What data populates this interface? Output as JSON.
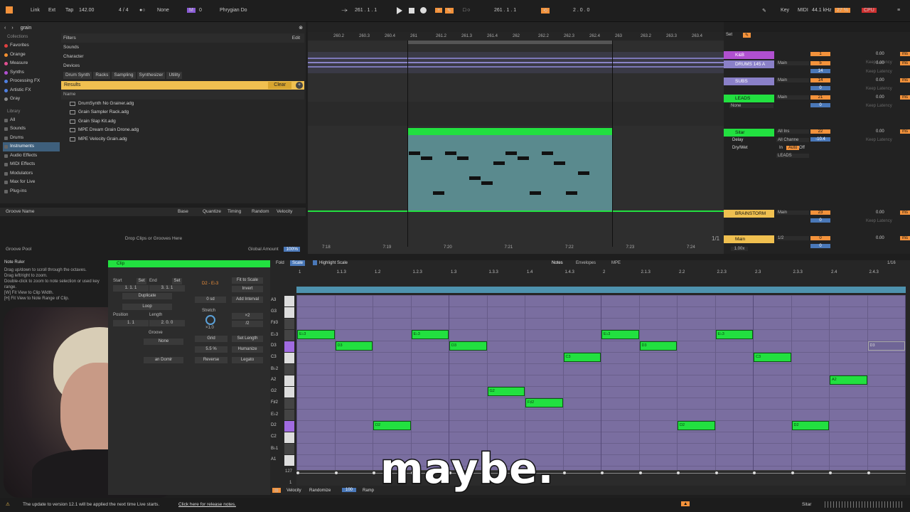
{
  "topbar": {
    "link": "Link",
    "ext": "Ext",
    "tap": "Tap",
    "tempo": "142.00",
    "sig": "4 / 4",
    "none1": "None",
    "key_num": "0",
    "scale": "Phrygian Do",
    "pos1": "261 .  1 .  1",
    "pos2": "261 .  1 .  1",
    "loop": "2 .  0 .  0",
    "key": "Key",
    "midi": "MIDI",
    "rate": "44.1 kHz",
    "cpu_pct": "27 %",
    "cpu": "CPU"
  },
  "browser": {
    "search": "grain",
    "filters": "Filters",
    "edit": "Edit",
    "sounds": "Sounds",
    "character": "Character",
    "devices": "Devices",
    "chips": [
      "Drum Synth",
      "Racks",
      "Sampling",
      "Synthesizer",
      "Utility"
    ],
    "collections_label": "Collections",
    "collections": [
      {
        "label": "Favorites",
        "color": "#e04040"
      },
      {
        "label": "Orange",
        "color": "#f39030"
      },
      {
        "label": "Measure",
        "color": "#e05090"
      },
      {
        "label": "Synths",
        "color": "#b050d0"
      },
      {
        "label": "Processing FX",
        "color": "#5080e0"
      },
      {
        "label": "Artistic FX",
        "color": "#5080e0"
      },
      {
        "label": "Gray",
        "color": "#888888"
      }
    ],
    "library_label": "Library",
    "library": [
      "All",
      "Sounds",
      "Drums",
      "Instruments",
      "Audio Effects",
      "MIDI Effects",
      "Modulators",
      "Max for Live",
      "Plug-ins"
    ],
    "results": "Results",
    "clear": "Clear",
    "name_col": "Name",
    "files": [
      "DrumSynth No Grainer.adg",
      "Grain Sampler Rack.adg",
      "Grain Slap Kit.adg",
      "MPE Dream Grain Drone.adg",
      "MPE Velocity Grain.adg"
    ]
  },
  "groove": {
    "name": "Groove Name",
    "base": "Base",
    "quantize": "Quantize",
    "timing": "Timing",
    "random": "Random",
    "velocity": "Velocity",
    "drop": "Drop Clips or Grooves Here",
    "pool": "Groove Pool",
    "global": "Global Amount",
    "global_pct": "100%"
  },
  "arrangement": {
    "bars": [
      "260.2",
      "260.3",
      "260.4",
      "261",
      "261.2",
      "261.3",
      "261.4",
      "262",
      "262.2",
      "262.3",
      "262.4",
      "263",
      "263.2",
      "263.3",
      "263.4"
    ],
    "times": [
      "7:18",
      "7:19",
      "7:20",
      "7:21",
      "7:22",
      "7:23",
      "7:24"
    ],
    "fraction": "1/1"
  },
  "mixer": {
    "set": "Set",
    "tracks": [
      {
        "name": "K&B",
        "color": "#b050d0",
        "out": "",
        "num": "1",
        "vol": "0.00"
      },
      {
        "name": "DRUMS 145 A",
        "color": "#8a80c8",
        "out": "Main",
        "num": "5",
        "vol": "0.00",
        "val2": "14"
      },
      {
        "name": "SUBS",
        "color": "#8a80c8",
        "out": "Main",
        "num": "14",
        "vol": "0.00",
        "val2": "0"
      },
      {
        "name": "LEADS",
        "color": "#22e040",
        "out": "Main",
        "num": "21",
        "vol": "0.00",
        "val2": "0"
      },
      {
        "name": "Sitar",
        "color": "#22e040",
        "out": "All Ins",
        "num": "22",
        "vol": "0.00",
        "val2": "-10.4"
      },
      {
        "name": "BRAINSTORM",
        "color": "#f0c050",
        "out": "Main",
        "num": "23",
        "vol": "0.00",
        "val2": "0"
      },
      {
        "name": "Main",
        "color": "#f0c050",
        "out": "1/2",
        "num": "0",
        "vol": "0.00",
        "val2": "0"
      }
    ],
    "none": "None",
    "delay": "Delay",
    "drywet": "Dry/Wet",
    "allchan": "All Channe",
    "leads_in": "LEADS",
    "in": "In",
    "auto": "Auto",
    "off": "Off",
    "keep": "Keep Latency",
    "zoom": "1.00x"
  },
  "noteruler": {
    "title": "Note Ruler",
    "lines": [
      "Drag up/down to scroll through the octaves.",
      "Drag left/right to zoom.",
      "Double-click to zoom to note selection or used key range.",
      "[W] Fit View to Clip Width.",
      "[H] Fit View to Note Range of Clip."
    ]
  },
  "clip": {
    "title": "Clip",
    "start": "Start",
    "end": "End",
    "set": "Set",
    "start_val": "1.  1.  1",
    "end_val": "3.  1.  1",
    "duplicate": "Duplicate",
    "loop": "Loop",
    "position": "Position",
    "length": "Length",
    "pos_val": "1.  1",
    "len_val": "2.  0.  0",
    "groove": "Groove",
    "groove_val": "None",
    "range": "D2 - E♭3",
    "fit": "Fit to Scale",
    "invert": "Invert",
    "sd": "0 sd",
    "interval": "Add Interval",
    "stretch": "Stretch",
    "x2": "×2",
    "d2": "/2",
    "stretch_val": "×1.0",
    "grid": "Grid",
    "setlen": "Set Length",
    "grid_pct": "5.5 %",
    "humanize": "Humanize",
    "reverse": "Reverse",
    "legato": "Legato",
    "scale_name": "an Domir"
  },
  "pianoroll": {
    "fold": "Fold",
    "scale": "Scale",
    "highlight": "Highlight Scale",
    "notes_tab": "Notes",
    "env_tab": "Envelopes",
    "mpe_tab": "MPE",
    "quant": "1/16",
    "ruler": [
      "1",
      "1.1.3",
      "1.2",
      "1.2.3",
      "1.3",
      "1.3.3",
      "1.4",
      "1.4.3",
      "2",
      "2.1.3",
      "2.2",
      "2.2.3",
      "2.3",
      "2.3.3",
      "2.4",
      "2.4.3"
    ],
    "keys": [
      "A3",
      "G3",
      "F♯3",
      "E♭3",
      "D3",
      "C3",
      "B♭2",
      "A2",
      "G2",
      "F♯2",
      "E♭2",
      "D2",
      "C2",
      "B♭1",
      "A1"
    ],
    "notes": [
      {
        "label": "E♭3",
        "row": 3,
        "start": 0,
        "len": 1
      },
      {
        "label": "D3",
        "row": 4,
        "start": 1,
        "len": 1
      },
      {
        "label": "D2",
        "row": 11,
        "start": 2,
        "len": 1
      },
      {
        "label": "E♭3",
        "row": 3,
        "start": 3,
        "len": 1
      },
      {
        "label": "D3",
        "row": 4,
        "start": 4,
        "len": 1
      },
      {
        "label": "G2",
        "row": 8,
        "start": 5,
        "len": 1
      },
      {
        "label": "F♯2",
        "row": 9,
        "start": 6,
        "len": 1
      },
      {
        "label": "C3",
        "row": 5,
        "start": 7,
        "len": 1
      },
      {
        "label": "E♭3",
        "row": 3,
        "start": 8,
        "len": 1
      },
      {
        "label": "D3",
        "row": 4,
        "start": 9,
        "len": 1
      },
      {
        "label": "D2",
        "row": 11,
        "start": 10,
        "len": 1
      },
      {
        "label": "E♭3",
        "row": 3,
        "start": 11,
        "len": 1
      },
      {
        "label": "C3",
        "row": 5,
        "start": 12,
        "len": 1
      },
      {
        "label": "D2",
        "row": 11,
        "start": 13,
        "len": 1
      },
      {
        "label": "A2",
        "row": 7,
        "start": 14,
        "len": 1
      },
      {
        "label": "D3",
        "row": 4,
        "start": 15,
        "len": 1,
        "ghost": true
      }
    ],
    "vel_max": "127",
    "vel_min": "1",
    "velocity": "Velocity",
    "randomize": "Randomize",
    "rand_val": "100",
    "ramp": "Ramp"
  },
  "status": {
    "update": "The update to version 12.1 will be applied the next time Live starts.",
    "release": "Click here for release notes.",
    "track": "Sitar"
  },
  "subtitle": "maybe."
}
